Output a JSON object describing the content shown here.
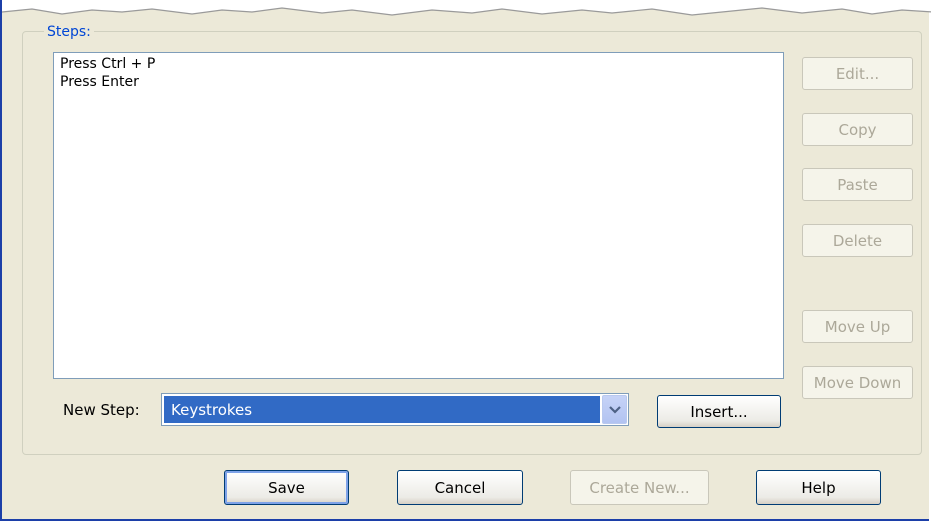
{
  "group": {
    "legend": "Steps:"
  },
  "steps": [
    "Press Ctrl + P",
    "Press Enter"
  ],
  "side_buttons": {
    "edit": "Edit...",
    "copy": "Copy",
    "paste": "Paste",
    "delete": "Delete",
    "move_up": "Move Up",
    "move_down": "Move Down"
  },
  "new_step": {
    "label": "New Step:",
    "selected": "Keystrokes",
    "insert_label": "Insert..."
  },
  "bottom_buttons": {
    "save": "Save",
    "cancel": "Cancel",
    "create_new": "Create New...",
    "help": "Help"
  },
  "icons": {
    "dropdown": "chevron-down-icon"
  },
  "colors": {
    "dialog_bg": "#ece9d8",
    "legend_text": "#0046d5",
    "selection": "#316ac5",
    "window_border": "#1c3fa8"
  }
}
